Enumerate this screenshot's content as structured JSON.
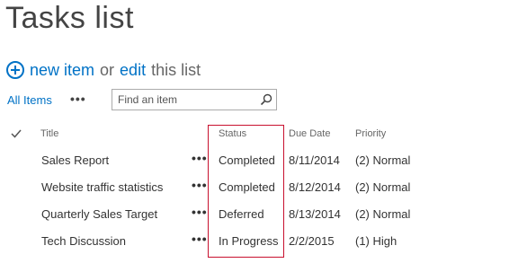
{
  "page": {
    "title": "Tasks list"
  },
  "command_bar": {
    "new_item": "new item",
    "or": "or",
    "edit": "edit",
    "this_list": "this list"
  },
  "view": {
    "current_view": "All Items",
    "more": "•••",
    "search_placeholder": "Find an item"
  },
  "table": {
    "columns": {
      "title": "Title",
      "status": "Status",
      "due_date": "Due Date",
      "priority": "Priority"
    },
    "rows": [
      {
        "title": "Sales Report",
        "menu": "•••",
        "status": "Completed",
        "due_date": "8/11/2014",
        "priority": "(2) Normal"
      },
      {
        "title": "Website traffic statistics",
        "menu": "•••",
        "status": "Completed",
        "due_date": "8/12/2014",
        "priority": "(2) Normal"
      },
      {
        "title": "Quarterly Sales Target",
        "menu": "•••",
        "status": "Deferred",
        "due_date": "8/13/2014",
        "priority": "(2) Normal"
      },
      {
        "title": "Tech Discussion",
        "menu": "•••",
        "status": "In Progress",
        "due_date": "2/2/2015",
        "priority": "(1) High"
      }
    ]
  },
  "colors": {
    "accent": "#0072c6",
    "highlight": "#c8102e",
    "text": "#333333"
  },
  "icons": {
    "add": "add-circle-icon",
    "search": "search-icon",
    "select_all": "checkmark-icon"
  }
}
